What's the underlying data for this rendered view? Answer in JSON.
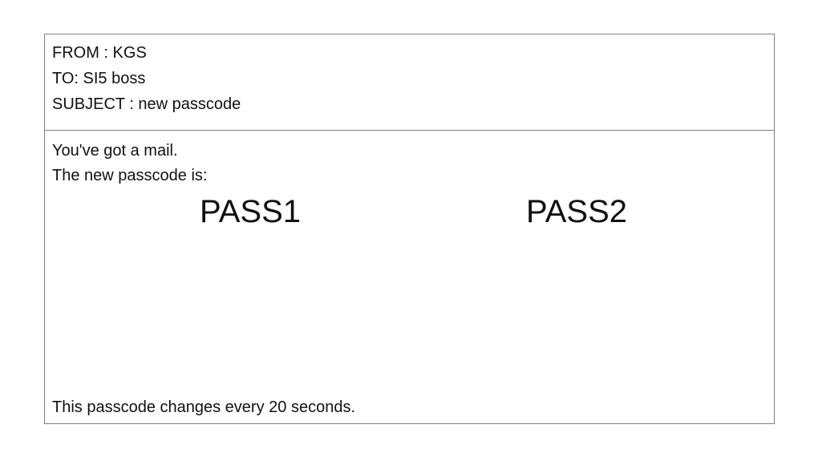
{
  "header": {
    "from": "FROM : KGS",
    "to": "TO: SI5 boss",
    "subject": "SUBJECT : new passcode"
  },
  "body": {
    "line1": "You've got a mail.",
    "line2": "The new passcode is:",
    "passcodes": [
      "PASS1",
      "PASS2"
    ],
    "footer": "This passcode changes every 20 seconds."
  }
}
